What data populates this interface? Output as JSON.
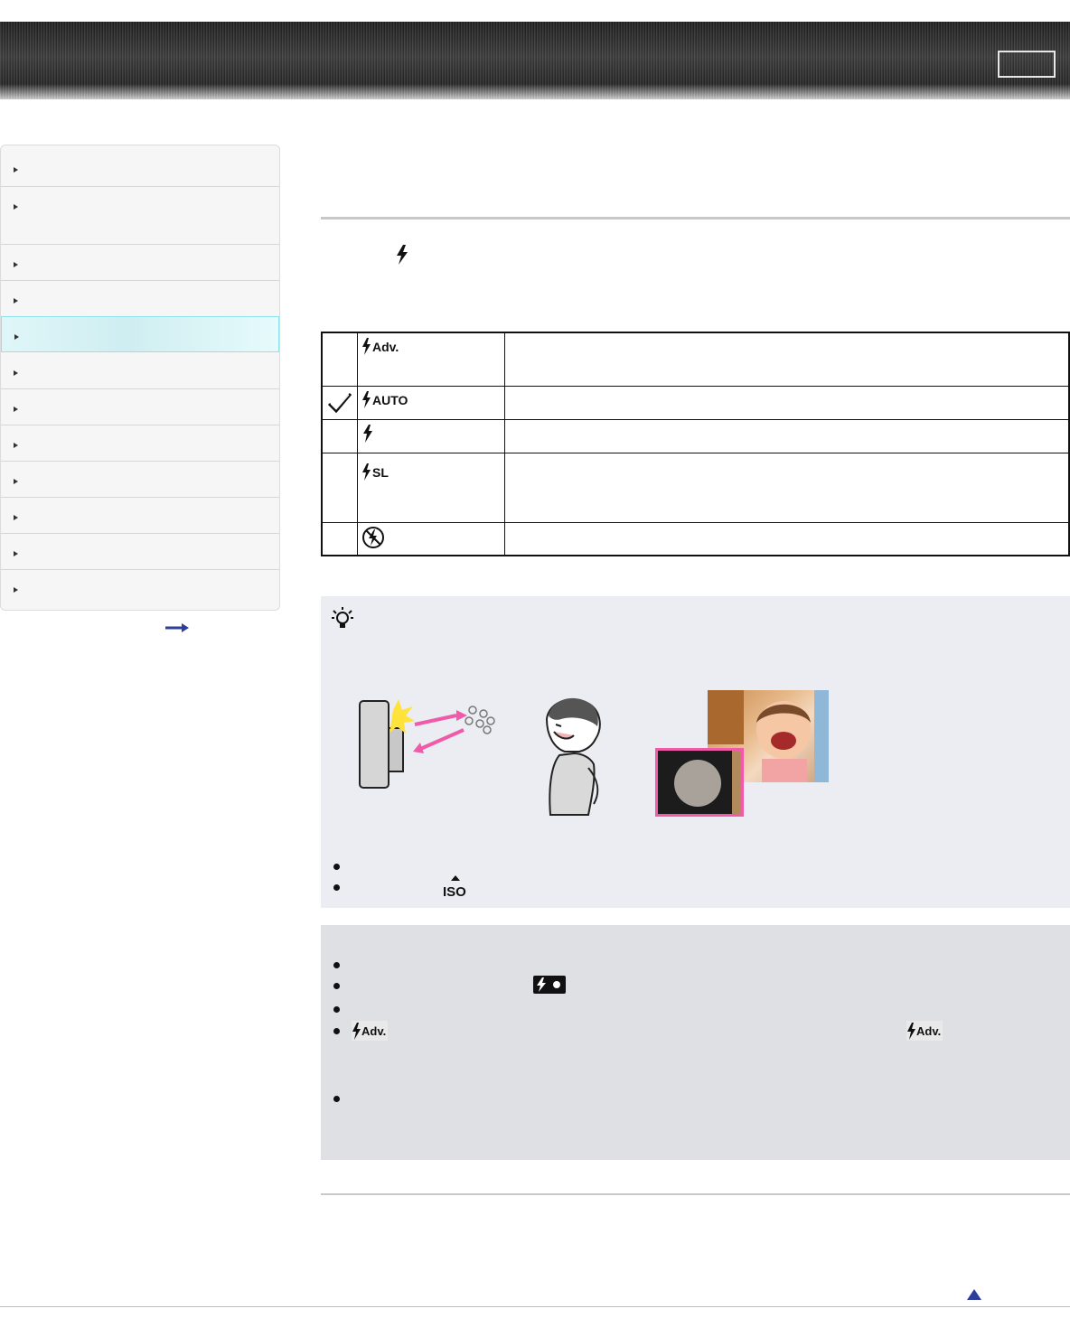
{
  "header": {
    "button_label": ""
  },
  "sidebar": {
    "items": [
      {
        "label": ""
      },
      {
        "label": ""
      },
      {
        "label": ""
      },
      {
        "label": ""
      },
      {
        "label": "",
        "active": true
      },
      {
        "label": ""
      },
      {
        "label": ""
      },
      {
        "label": ""
      },
      {
        "label": ""
      },
      {
        "label": ""
      },
      {
        "label": ""
      },
      {
        "label": ""
      }
    ]
  },
  "icons": {
    "title": "flash-icon",
    "modes": [
      "flash-adv-icon",
      "flash-auto-icon",
      "flash-on-icon",
      "flash-slow-sync-icon",
      "flash-off-icon"
    ],
    "selected": "checkmark-icon",
    "hint": "lightbulb-hint-icon",
    "iso": "iso-auto-icon",
    "flash_badge": "flash-charging-badge",
    "page_top": "page-top-icon",
    "more": "right-arrow-icon"
  },
  "mode_labels": {
    "adv": "Adv.",
    "auto": "AUTO",
    "sl": "SL"
  },
  "iso_label": "ISO",
  "colors": {
    "accent_pink": "#f05aa8",
    "sidebar_active": "#dff6f8",
    "hint_bg": "#ecedf2",
    "note_bg": "#dfe0e4"
  }
}
